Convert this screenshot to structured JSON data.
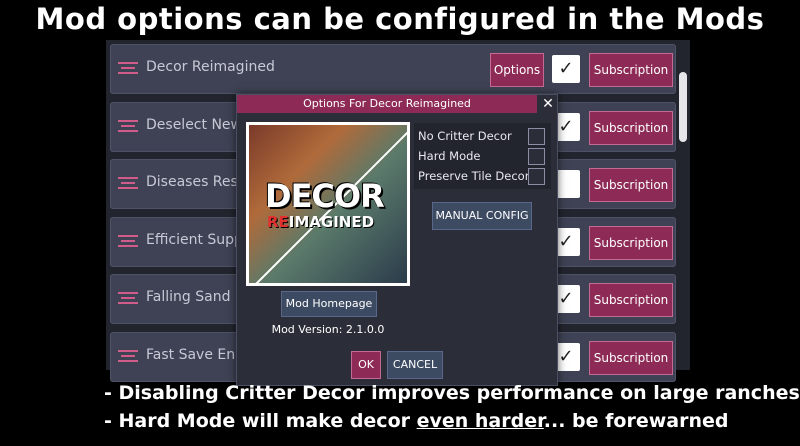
{
  "caption": {
    "title": "Mod options can be configured in the Mods menu"
  },
  "mods": [
    {
      "name": "Decor Reimagined",
      "options_label": "Options",
      "checked": true,
      "subscription_label": "Subscription"
    },
    {
      "name": "Deselect New M",
      "checked": true,
      "subscription_label": "Subscription"
    },
    {
      "name": "Diseases Resto",
      "checked": false,
      "subscription_label": "Subscription"
    },
    {
      "name": "Efficient Suppl",
      "checked": true,
      "subscription_label": "Subscription"
    },
    {
      "name": "Falling Sand",
      "checked": true,
      "subscription_label": "Subscription"
    },
    {
      "name": "Fast Save Enha",
      "checked": true,
      "subscription_label": "Subscription"
    }
  ],
  "dialog": {
    "title": "Options For Decor Reimagined",
    "close": "✕",
    "art_word1": "DECOR",
    "art_word2_a": "RE",
    "art_word2_b": "IMAGINED",
    "options": [
      {
        "label": "No Critter Decor",
        "checked": false
      },
      {
        "label": "Hard Mode",
        "checked": false
      },
      {
        "label": "Preserve Tile Decor",
        "checked": false
      }
    ],
    "manual_config": "MANUAL CONFIG",
    "homepage": "Mod Homepage",
    "version": "Mod Version: 2.1.0.0",
    "ok": "OK",
    "cancel": "CANCEL"
  },
  "notes": {
    "line1": "- Disabling Critter Decor improves performance on large ranches",
    "line2_a": "- Hard Mode will make decor ",
    "line2_b": "even harder",
    "line2_c": "... be forewarned"
  },
  "colors": {
    "accent": "#8e2a56",
    "panel": "#23252e",
    "row": "#3e4254"
  }
}
